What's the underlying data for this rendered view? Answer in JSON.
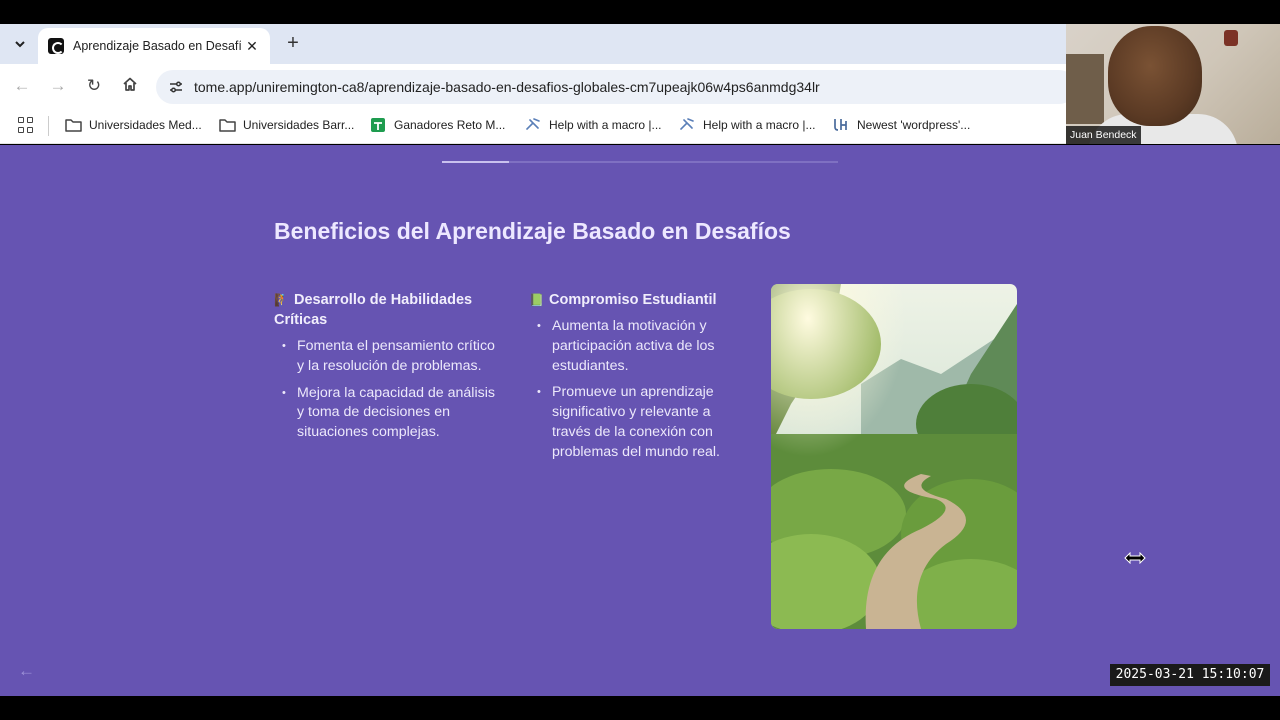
{
  "browser": {
    "tab": {
      "title": "Aprendizaje Basado en Desafíos",
      "close_label": "✕",
      "favicon": "tome-icon"
    },
    "new_tab_label": "+",
    "nav": {
      "back": "←",
      "forward": "→",
      "reload": "↻"
    },
    "url": "tome.app/uniremington-ca8/aprendizaje-basado-en-desafios-globales-cm7upeajk06w4ps6anmdg34lr",
    "bookmarks": [
      {
        "label": "Universidades Med...",
        "icon": "folder-icon"
      },
      {
        "label": "Universidades Barr...",
        "icon": "folder-icon"
      },
      {
        "label": "Ganadores Reto M...",
        "icon": "sheets-icon"
      },
      {
        "label": "Help with a macro |...",
        "icon": "forum-icon"
      },
      {
        "label": "Help with a macro |...",
        "icon": "forum-icon"
      },
      {
        "label": "Newest 'wordpress'...",
        "icon": "stackexchange-icon"
      }
    ]
  },
  "webcam": {
    "participant_name": "Juan Bendeck"
  },
  "slide": {
    "title": "Beneficios del Aprendizaje Basado en Desafíos",
    "progress_fraction": 0.17,
    "columns": [
      {
        "emoji": "🧗",
        "heading": "Desarrollo de Habilidades Críticas",
        "bullets": [
          "Fomenta el pensamiento crítico y la resolución de problemas.",
          "Mejora la capacidad de análisis y toma de decisiones en situaciones complejas."
        ]
      },
      {
        "emoji": "📗",
        "heading": "Compromiso Estudiantil",
        "bullets": [
          "Aumenta la motivación y participación activa de los estudiantes.",
          "Promueve un aprendizaje significativo y relevante a través de la conexión con problemas del mundo real."
        ]
      }
    ],
    "back_arrow": "←"
  },
  "timestamp": "2025-03-21  15:10:07",
  "colors": {
    "slide_background": "#6654b2",
    "title_text": "#ede8ff",
    "tabstrip": "#dfe6f3"
  }
}
